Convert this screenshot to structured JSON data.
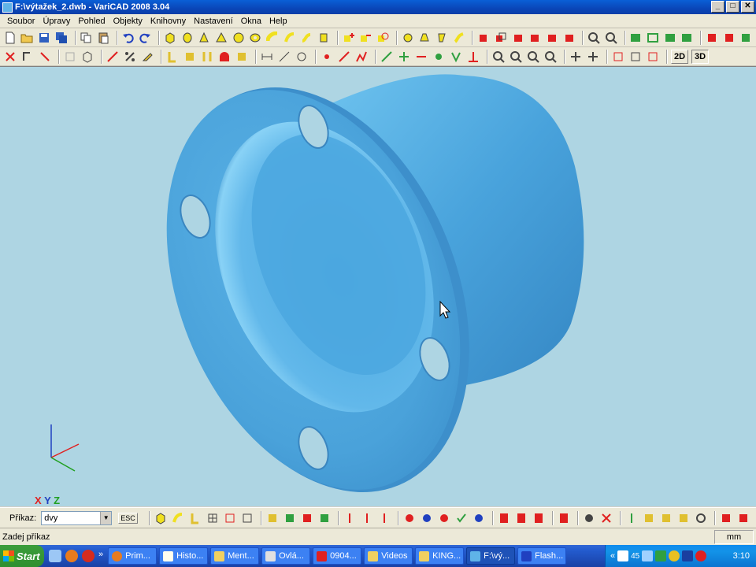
{
  "window": {
    "title": "F:\\výtažek_2.dwb - VariCAD 2008 3.04",
    "min": "_",
    "max": "□",
    "close": "✕"
  },
  "menu": [
    "Soubor",
    "Úpravy",
    "Pohled",
    "Objekty",
    "Knihovny",
    "Nastavení",
    "Okna",
    "Help"
  ],
  "toolbar2": {
    "btn_2d": "2D",
    "btn_3d": "3D"
  },
  "viewport": {
    "background": "#aed5e3",
    "model_color": "#4aa6dd",
    "axes": [
      "X",
      "Y",
      "Z"
    ]
  },
  "command": {
    "label": "Příkaz:",
    "value": "dvy",
    "esc": "ESC"
  },
  "status": {
    "text": "Zadej příkaz",
    "unit": "mm"
  },
  "taskbar": {
    "start": "Start",
    "quicklaunch_more": "»",
    "tasks": [
      "Prim...",
      "Histo...",
      "Ment...",
      "Ovlá...",
      "0904...",
      "Videos",
      "KING...",
      "F:\\vý...",
      "Flash..."
    ],
    "active_task": 7,
    "tray_more": "«",
    "tray_num": "45",
    "clock": "3:10"
  }
}
